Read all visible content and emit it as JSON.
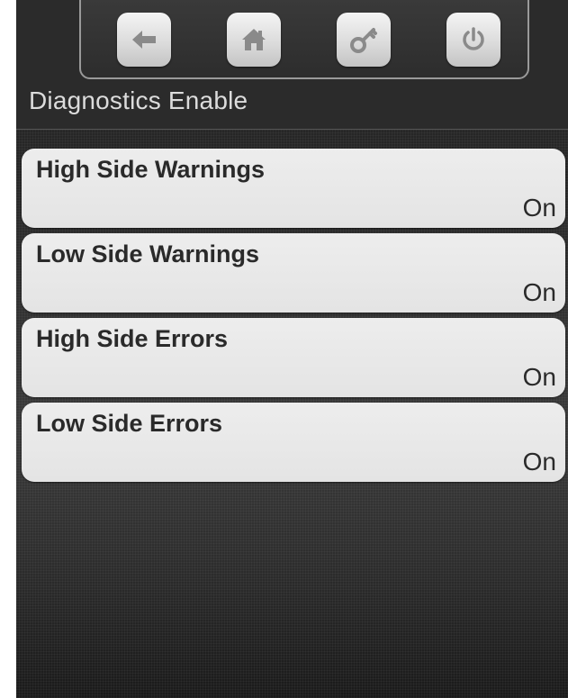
{
  "header": {
    "title": "Diagnostics Enable",
    "nav": [
      {
        "icon": "back-arrow-icon"
      },
      {
        "icon": "home-icon"
      },
      {
        "icon": "key-icon"
      },
      {
        "icon": "power-icon"
      }
    ]
  },
  "items": [
    {
      "label": "High Side Warnings",
      "value": "On"
    },
    {
      "label": "Low Side Warnings",
      "value": "On"
    },
    {
      "label": "High Side Errors",
      "value": "On"
    },
    {
      "label": "Low Side Errors",
      "value": "On"
    }
  ],
  "colors": {
    "background": "#2b2b2b",
    "item_background": "#e8e8e8",
    "item_text": "#2a2a2a",
    "title_text": "#dcdcdc",
    "icon": "#8a8a8a"
  }
}
